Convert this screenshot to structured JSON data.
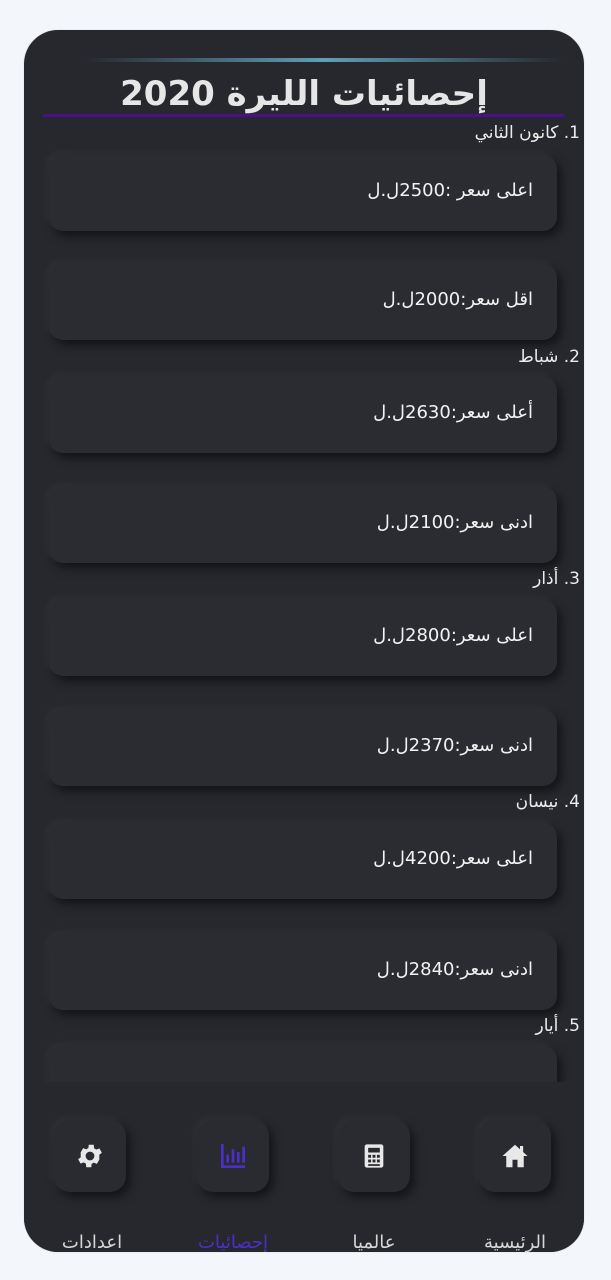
{
  "page": {
    "title": "إحصائيات الليرة 2020"
  },
  "months": [
    {
      "label": "1. كانون الثاني",
      "cards": [
        "اعلى سعر :2500ل.ل",
        "اقل سعر:2000ل.ل"
      ]
    },
    {
      "label": "2. شباط",
      "cards": [
        "أعلى سعر:2630ل.ل",
        "ادنى سعر:2100ل.ل"
      ]
    },
    {
      "label": "3. أذار",
      "cards": [
        "اعلى سعر:2800ل.ل",
        "ادنى سعر:2370ل.ل"
      ]
    },
    {
      "label": "4. نيسان",
      "cards": [
        "اعلى سعر:4200ل.ل",
        "ادنى سعر:2840ل.ل"
      ]
    },
    {
      "label": "5. أيار",
      "cards": [
        ""
      ]
    }
  ],
  "nav": {
    "items": [
      {
        "label": "الرئيسية",
        "icon": "home-icon",
        "active": false
      },
      {
        "label": "عالميا",
        "icon": "calculator-icon",
        "active": false
      },
      {
        "label": "إحصائيات",
        "icon": "chart-icon",
        "active": true
      },
      {
        "label": "اعدادات",
        "icon": "gear-icon",
        "active": false
      }
    ],
    "accent": "#4c2fc7"
  }
}
